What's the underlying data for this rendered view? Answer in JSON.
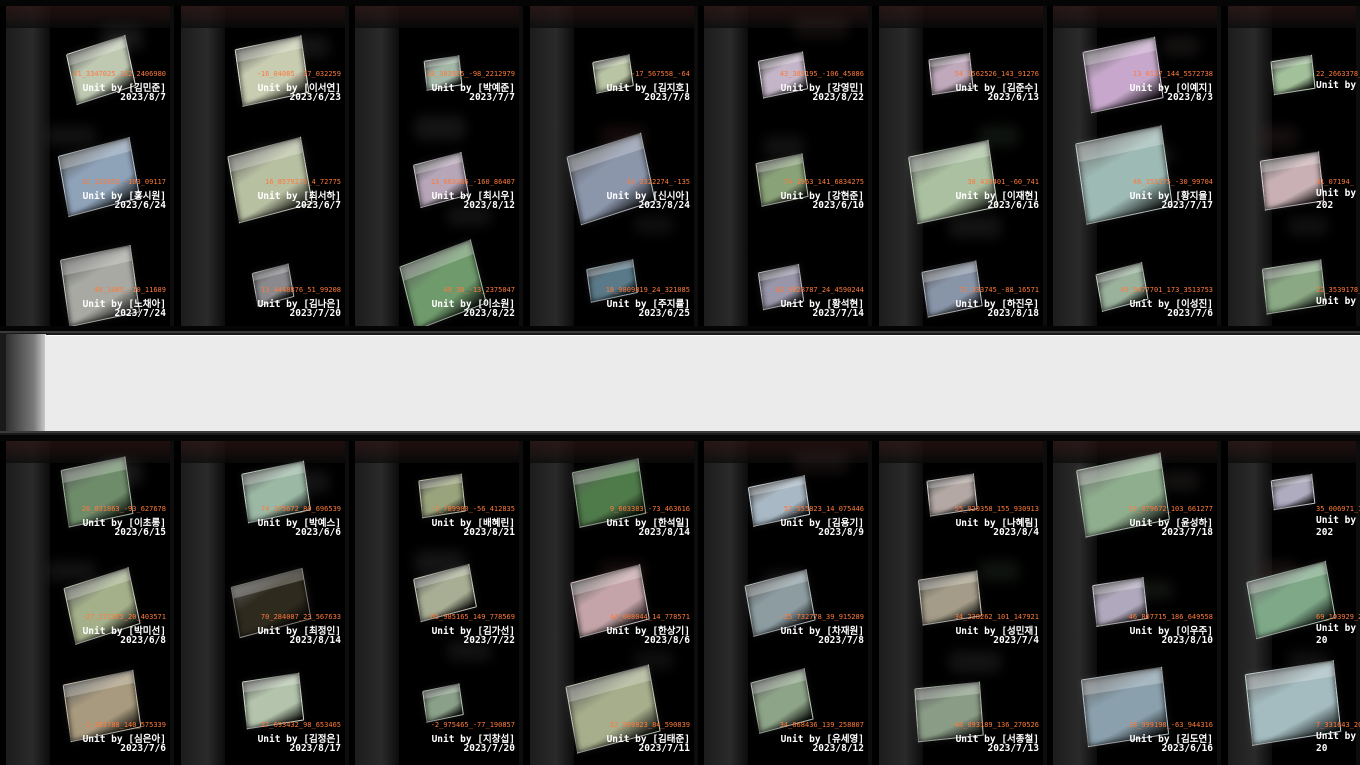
{
  "colors": {
    "coords": "#ff7a3a",
    "text": "#ffffff",
    "background": "#000000",
    "panel": "#ebebeb"
  },
  "top_columns": [
    {
      "cells": [
        {
          "coords": "41_3347025_132_2406980",
          "unit": "Unit by [김민준]",
          "date": "2023/8/7",
          "color": "#bfc9b2"
        },
        {
          "coords": "31_115853_-103_09117",
          "unit": "Unit by [홍시원]",
          "date": "2023/6/24",
          "color": "#8ea2b8"
        },
        {
          "coords": "49_1085_-10_11689",
          "unit": "Unit by [노채아]",
          "date": "2023/7/24",
          "color": "#a7a9a2"
        }
      ]
    },
    {
      "cells": [
        {
          "coords": "-16_04085_-37_032259",
          "unit": "Unit by [이서연]",
          "date": "2023/6/23",
          "color": "#c8ccb0"
        },
        {
          "coords": "16_8579275_4_72775",
          "unit": "Unit by [최서하]",
          "date": "2023/6/7",
          "color": "#b8c0a2"
        },
        {
          "coords": "13_4448876_51_99208",
          "unit": "Unit by [김나은]",
          "date": "2023/7/20",
          "color": "#8a8a8e"
        }
      ]
    },
    {
      "cells": [
        {
          "coords": "18_383925_-98_2212979",
          "unit": "Unit by [박예준]",
          "date": "2023/7/7",
          "color": "#a4b8a8"
        },
        {
          "coords": "13_663266_-160_86407",
          "unit": "Unit by [최시우]",
          "date": "2023/8/12",
          "color": "#b6a6b8"
        },
        {
          "coords": "49_38_-13_2375047",
          "unit": "Unit by [이소원]",
          "date": "2023/8/22",
          "color": "#6f9a6c"
        }
      ]
    },
    {
      "cells": [
        {
          "coords": "-17_567558_-64",
          "unit": "Unit by [김지호]",
          "date": "2023/7/8",
          "color": "#b9c4a4"
        },
        {
          "coords": "43_2322274_-135",
          "unit": "Unit by [신시아]",
          "date": "2023/8/24",
          "color": "#8b96ab"
        },
        {
          "coords": "18_9809819_24_321085",
          "unit": "Unit by [주지률]",
          "date": "2023/6/25",
          "color": "#5a7a8a"
        }
      ]
    },
    {
      "cells": [
        {
          "coords": "43_389195_-106_45086",
          "unit": "Unit by [강영민]",
          "date": "2023/8/22",
          "color": "#c4b6c8"
        },
        {
          "coords": "74_1963_141_6834275",
          "unit": "Unit by [강현준]",
          "date": "2023/6/10",
          "color": "#8aa278"
        },
        {
          "coords": "83_9928787_24_4590244",
          "unit": "Unit by [황석현]",
          "date": "2023/7/14",
          "color": "#9a96aa"
        }
      ]
    },
    {
      "cells": [
        {
          "coords": "54_1562526_143_91276",
          "unit": "Unit by [김준수]",
          "date": "2023/6/13",
          "color": "#bfa9bb"
        },
        {
          "coords": "38_439401_-60_741",
          "unit": "Unit by [이재현]",
          "date": "2023/6/16",
          "color": "#aac0a0"
        },
        {
          "coords": "72_333745_-88_16571",
          "unit": "Unit by [하진우]",
          "date": "2023/8/18",
          "color": "#8894a8"
        }
      ]
    },
    {
      "cells": [
        {
          "coords": "13_0137_144_5572738",
          "unit": "Unit by [이예지]",
          "date": "2023/8/3",
          "color": "#c7a8cc"
        },
        {
          "coords": "46_155175_-30_99704",
          "unit": "Unit by [황지율]",
          "date": "2023/7/17",
          "color": "#9ebab4"
        },
        {
          "coords": "49_9477701_173_3513753",
          "unit": "Unit by [이성진]",
          "date": "2023/7/6",
          "color": "#9ab29c"
        }
      ]
    },
    {
      "cells": [
        {
          "coords": "22_2663378_68_",
          "unit": "Unit by [",
          "date": "",
          "color": "#a2c09a"
        },
        {
          "coords": "41_07194_",
          "unit": "Unit by [",
          "date": "202",
          "color": "#c8b0b4"
        },
        {
          "coords": "22_3539178_12",
          "unit": "Unit by [",
          "date": "",
          "color": "#8aa884"
        }
      ]
    }
  ],
  "bottom_columns": [
    {
      "cells": [
        {
          "coords": "26_831863_-93_627678",
          "unit": "Unit by [이초롱]",
          "date": "2023/6/15",
          "color": "#6e8c6a"
        },
        {
          "coords": "-27_272925_20_403571",
          "unit": "Unit by [박미선]",
          "date": "2023/6/8",
          "color": "#a4b08a"
        },
        {
          "coords": "-1_203788_140_575339",
          "unit": "Unit by [심은아]",
          "date": "2023/7/6",
          "color": "#a89a7e"
        }
      ]
    },
    {
      "cells": [
        {
          "coords": "74_375672_80_696539",
          "unit": "Unit by [박예스]",
          "date": "2023/6/6",
          "color": "#9ab8a4"
        },
        {
          "coords": "70_284087_23_567633",
          "unit": "Unit by [최정인]",
          "date": "2023/8/14",
          "color": "#2e2a1e"
        },
        {
          "coords": "27_693432_98_653465",
          "unit": "Unit by [김정은]",
          "date": "2023/8/17",
          "color": "#b4c4ac"
        }
      ]
    },
    {
      "cells": [
        {
          "coords": "-3_789900_-56_412835",
          "unit": "Unit by [배혜린]",
          "date": "2023/8/21",
          "color": "#9aa47c"
        },
        {
          "coords": "65_985165_149_778569",
          "unit": "Unit by [김가선]",
          "date": "2023/7/22",
          "color": "#a8ae94"
        },
        {
          "coords": "-2_975465_-77_190857",
          "unit": "Unit by [지창섭]",
          "date": "2023/7/20",
          "color": "#8aa088"
        }
      ]
    },
    {
      "cells": [
        {
          "coords": "9_603383_-73_463616",
          "unit": "Unit by [한석일]",
          "date": "2023/8/14",
          "color": "#4f7a4a"
        },
        {
          "coords": "44_008044_14_778571",
          "unit": "Unit by [한상기]",
          "date": "2023/8/6",
          "color": "#c4a4a8"
        },
        {
          "coords": "22_999823_84_590839",
          "unit": "Unit by [김태준]",
          "date": "2023/7/11",
          "color": "#a6ae8c"
        }
      ]
    },
    {
      "cells": [
        {
          "coords": "57_555823_14_075446",
          "unit": "Unit by [김용기]",
          "date": "2023/8/9",
          "color": "#a8b8c4"
        },
        {
          "coords": "-25_732778_39_915289",
          "unit": "Unit by [차재원]",
          "date": "2023/7/8",
          "color": "#8c9ca0"
        },
        {
          "coords": "34_868436_139_258807",
          "unit": "Unit by [유세영]",
          "date": "2023/8/12",
          "color": "#8ea488"
        }
      ]
    },
    {
      "cells": [
        {
          "coords": "55_020358_155_930913",
          "unit": "Unit by [나혜림]",
          "date": "2023/8/4",
          "color": "#b4a8a4"
        },
        {
          "coords": "34_238262_101_147921",
          "unit": "Unit by [성민재]",
          "date": "2023/7/4",
          "color": "#a49c88"
        },
        {
          "coords": "48_093189_136_270526",
          "unit": "Unit by [서종철]",
          "date": "2023/7/13",
          "color": "#8a9c86"
        }
      ]
    },
    {
      "cells": [
        {
          "coords": "53_079672_103_661277",
          "unit": "Unit by [윤성하]",
          "date": "2023/7/18",
          "color": "#8fae8e"
        },
        {
          "coords": "46_807715_186_649558",
          "unit": "Unit by [이우주]",
          "date": "2023/8/10",
          "color": "#b0a8bc"
        },
        {
          "coords": "18_999198_-63_944316",
          "unit": "Unit by [김도연]",
          "date": "2023/6/16",
          "color": "#8aa0ac"
        }
      ]
    },
    {
      "cells": [
        {
          "coords": "35_006971_1",
          "unit": "Unit by [",
          "date": "202",
          "color": "#b0acc0"
        },
        {
          "coords": "69_103929_2",
          "unit": "Unit by [",
          "date": "20",
          "color": "#7ea888"
        },
        {
          "coords": "7_331643_20",
          "unit": "Unit by",
          "date": "20",
          "color": "#a4bcc0"
        }
      ]
    }
  ]
}
